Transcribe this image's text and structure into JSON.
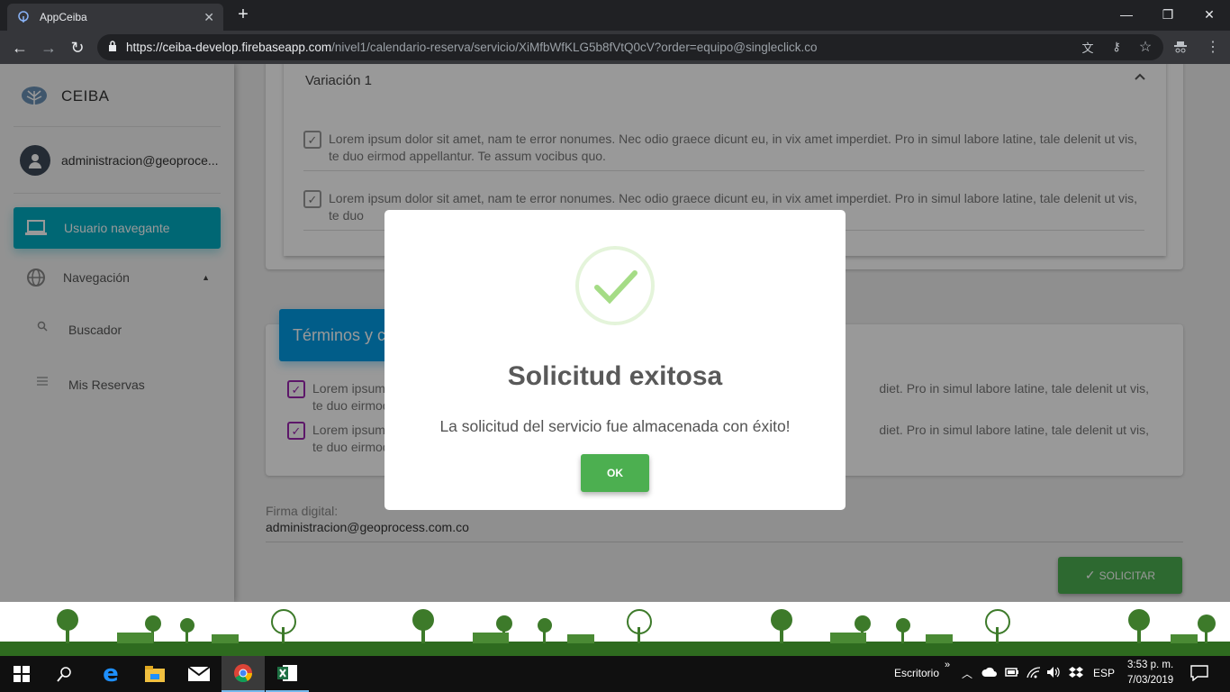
{
  "browser": {
    "tab_title": "AppCeiba",
    "url_host": "https://ceiba-develop.firebaseapp.com",
    "url_path": "/nivel1/calendario-reserva/servicio/XiMfbWfKLG5b8fVtQ0cV?order=equipo@singleclick.co"
  },
  "sidebar": {
    "brand": "CEIBA",
    "user": "administracion@geoproce...",
    "items": [
      {
        "label": "Usuario navegante",
        "icon": "laptop-icon"
      },
      {
        "label": "Navegación",
        "icon": "globe-icon"
      },
      {
        "label": "Buscador",
        "icon": "search-icon"
      },
      {
        "label": "Mis Reservas",
        "icon": "list-icon"
      }
    ]
  },
  "variation": {
    "title": "Variación 1",
    "items": [
      "Lorem ipsum dolor sit amet, nam te error nonumes. Nec odio graece dicunt eu, in vix amet imperdiet. Pro in simul labore latine, tale delenit ut vis, te duo eirmod appellantur. Te assum vocibus quo.",
      "Lorem ipsum dolor sit amet, nam te error nonumes. Nec odio graece dicunt eu, in vix amet imperdiet. Pro in simul labore latine, tale delenit ut vis, te duo"
    ]
  },
  "terms": {
    "title": "Términos y c",
    "items": [
      "Lorem ipsum                                                                                                                                             diet. Pro in simul labore latine, tale delenit ut vis, te duo eirmod appella",
      "Lorem ipsum                                                                                                                                             diet. Pro in simul labore latine, tale delenit ut vis, te duo eirmod appella"
    ]
  },
  "signature": {
    "label": "Firma digital:",
    "value": "administracion@geoprocess.com.co"
  },
  "solicitar_label": "SOLICITAR",
  "modal": {
    "title": "Solicitud exitosa",
    "text": "La solicitud del servicio fue almacenada con éxito!",
    "ok_label": "OK"
  },
  "taskbar": {
    "desktop_label": "Escritorio",
    "lang": "ESP",
    "time": "3:53 p. m.",
    "date": "7/03/2019"
  },
  "colors": {
    "accent_cyan": "#00acc1",
    "accent_blue": "#039be5",
    "success_green": "#4caf50",
    "check_purple": "#9c27b0"
  }
}
